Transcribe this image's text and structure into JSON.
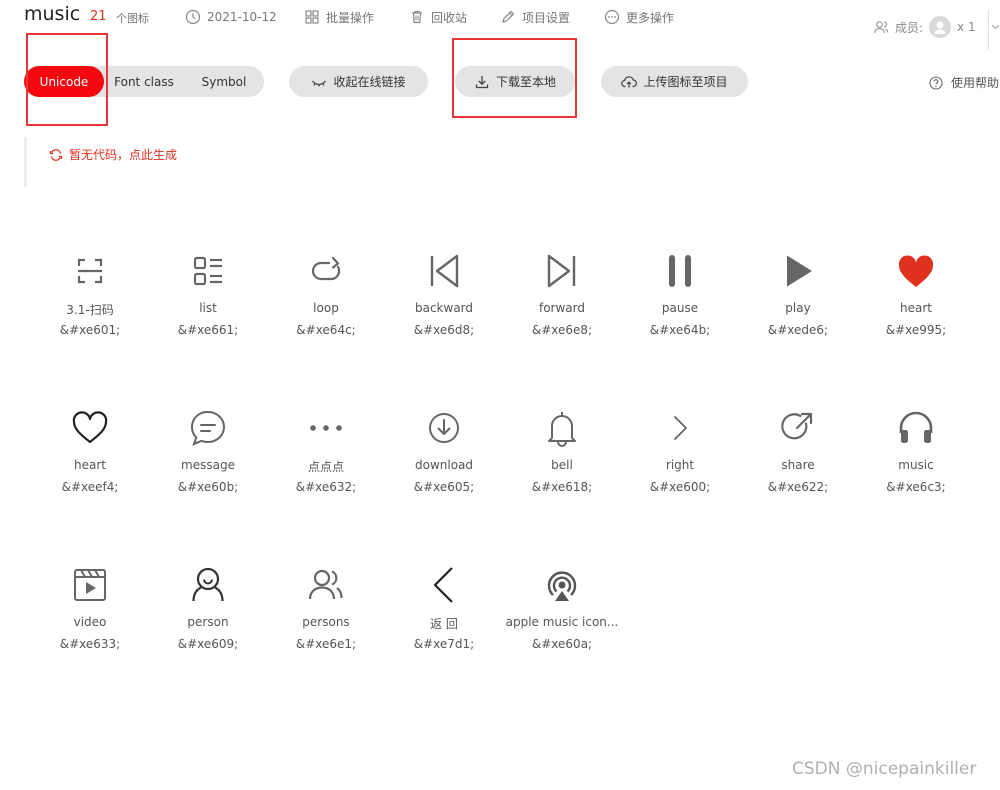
{
  "header": {
    "title": "music",
    "count": "21",
    "count_label": "个图标",
    "date": "2021-10-12",
    "batch": "批量操作",
    "trash": "回收站",
    "settings": "项目设置",
    "more": "更多操作",
    "members_label": "成员:",
    "members_count": "x 1"
  },
  "tabs": {
    "unicode": "Unicode",
    "font_class": "Font class",
    "symbol": "Symbol"
  },
  "toolbar": {
    "collapse": "收起在线链接",
    "download": "下载至本地",
    "upload": "上传图标至项目",
    "help": "使用帮助"
  },
  "notice": {
    "generate": "暂无代码，点此生成"
  },
  "colors": {
    "accent": "#f5070f",
    "heart": "#e0301e",
    "icon": "#666666"
  },
  "icons": [
    {
      "name": "3.1-扫码",
      "code": "&#xe601;",
      "glyph": "scan-icon"
    },
    {
      "name": "list",
      "code": "&#xe661;",
      "glyph": "list-icon"
    },
    {
      "name": "loop",
      "code": "&#xe64c;",
      "glyph": "loop-icon"
    },
    {
      "name": "backward",
      "code": "&#xe6d8;",
      "glyph": "backward-icon"
    },
    {
      "name": "forward",
      "code": "&#xe6e8;",
      "glyph": "forward-icon"
    },
    {
      "name": "pause",
      "code": "&#xe64b;",
      "glyph": "pause-icon"
    },
    {
      "name": "play",
      "code": "&#xede6;",
      "glyph": "play-icon"
    },
    {
      "name": "heart",
      "code": "&#xe995;",
      "glyph": "heart-filled-icon"
    },
    {
      "name": "heart",
      "code": "&#xeef4;",
      "glyph": "heart-outline-icon"
    },
    {
      "name": "message",
      "code": "&#xe60b;",
      "glyph": "message-icon"
    },
    {
      "name": "点点点",
      "code": "&#xe632;",
      "glyph": "dots-icon"
    },
    {
      "name": "download",
      "code": "&#xe605;",
      "glyph": "download-circle-icon"
    },
    {
      "name": "bell",
      "code": "&#xe618;",
      "glyph": "bell-icon"
    },
    {
      "name": "right",
      "code": "&#xe600;",
      "glyph": "chevron-right-icon"
    },
    {
      "name": "share",
      "code": "&#xe622;",
      "glyph": "share-icon"
    },
    {
      "name": "music",
      "code": "&#xe6c3;",
      "glyph": "headphones-icon"
    },
    {
      "name": "video",
      "code": "&#xe633;",
      "glyph": "video-icon"
    },
    {
      "name": "person",
      "code": "&#xe609;",
      "glyph": "person-icon"
    },
    {
      "name": "persons",
      "code": "&#xe6e1;",
      "glyph": "persons-icon"
    },
    {
      "name": "返 回",
      "code": "&#xe7d1;",
      "glyph": "back-icon"
    },
    {
      "name": "apple music icon...",
      "code": "&#xe60a;",
      "glyph": "airplay-icon"
    }
  ],
  "watermark": "CSDN @nicepainkiller"
}
